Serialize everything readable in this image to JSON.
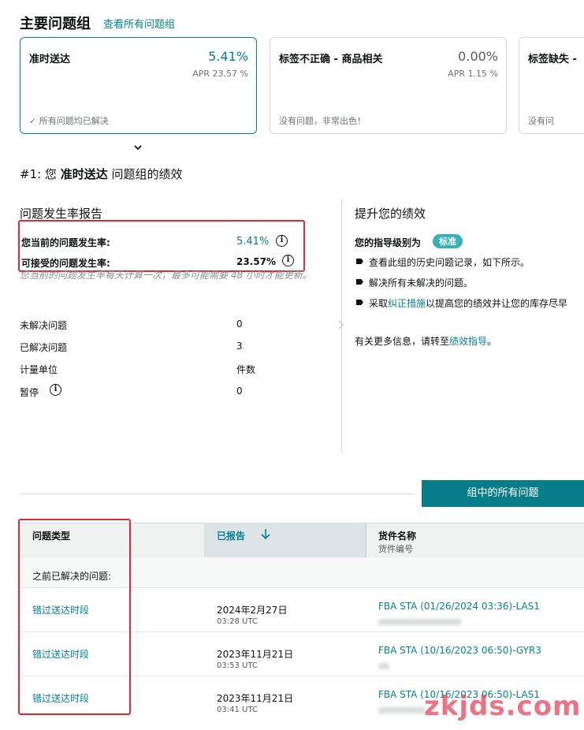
{
  "header": {
    "title": "主要问题组",
    "view_all_link": "查看所有问题组"
  },
  "cards": [
    {
      "title": "准时送达",
      "value": "5.41%",
      "apr": "APR 23.57 %",
      "status": "所有问题均已解决",
      "selected": true
    },
    {
      "title": "标签不正确 - 商品相关",
      "value": "0.00%",
      "apr": "APR 1.15 %",
      "status": "没有问题，非常出色！",
      "selected": false
    },
    {
      "title": "标签缺失 -",
      "status": "没有问",
      "selected": false
    }
  ],
  "subheading": {
    "prefix": "#1: 您 ",
    "group": "准时送达",
    "suffix": " 问题组的绩效"
  },
  "report": {
    "title": "问题发生率报告",
    "current_rate_label": "您当前的问题发生率:",
    "current_rate_value": "5.41%",
    "acceptable_rate_label": "可接受的问题发生率:",
    "acceptable_rate_value": "23.57%",
    "note": "您当前的问题发生率每天计算一次，最多可能需要 48 小时才能更新。",
    "rows": [
      {
        "label": "未解决问题",
        "value": "0"
      },
      {
        "label": "已解决问题",
        "value": "3"
      },
      {
        "label": "计量单位",
        "value": "件数"
      },
      {
        "label": "暂停",
        "value": "0"
      }
    ]
  },
  "improve": {
    "title": "提升您的绩效",
    "level_label": "您的指导级别为",
    "level_badge": "标准",
    "bullets": [
      {
        "text": "查看此组的历史问题记录，如下所示。"
      },
      {
        "text": "解决所有未解决的问题。"
      },
      {
        "pre": "采取",
        "link": "纠正措施",
        "post": "以提高您的绩效并让您的库存尽早"
      }
    ],
    "more_pre": "有关更多信息，请转至",
    "more_link": "绩效指导",
    "more_post": "。"
  },
  "all_issues_button": "组中的所有问题",
  "table": {
    "headers": {
      "type": "问题类型",
      "reported": "已报告",
      "shipment_name": "货件名称",
      "shipment_id": "货件编号"
    },
    "section_label": "之前已解决的问题:",
    "rows": [
      {
        "type": "错过送达时段",
        "date": "2024年2月27日",
        "time": "03:28 UTC",
        "shipment": "FBA STA (01/26/2024 03:36)-LAS1"
      },
      {
        "type": "错过送达时段",
        "date": "2023年11月21日",
        "time": "03:53 UTC",
        "shipment": "FBA STA (10/16/2023 06:50)-GYR3"
      },
      {
        "type": "错过送达时段",
        "date": "2023年11月21日",
        "time": "03:41 UTC",
        "shipment": "FBA STA (10/16/2023 06:50)-LAS1"
      }
    ]
  },
  "icons": {
    "check": "check-icon",
    "chevron": "chevron-down-icon",
    "info": "info-icon",
    "sort": "arrow-down-icon",
    "bullet": "arrow-bullet-icon"
  },
  "colors": {
    "accent": "#008296",
    "button": "#077d8a",
    "highlight_box": "#e3292f",
    "badge_bg": "#34b1bc"
  },
  "watermark": "zkjds.com"
}
